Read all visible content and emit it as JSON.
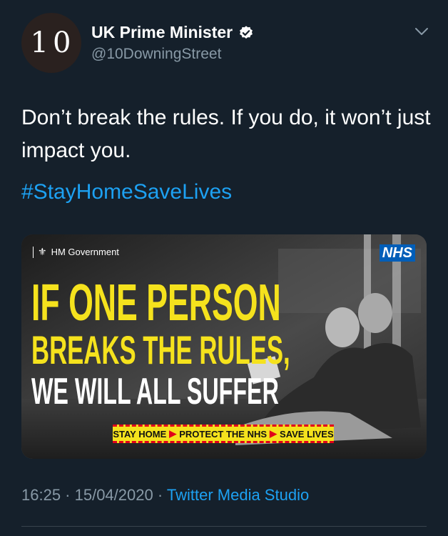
{
  "tweet": {
    "avatar_text": "10",
    "display_name": "UK Prime Minister",
    "handle": "@10DowningStreet",
    "verified": true,
    "menu_icon": "chevron-down-icon",
    "text": "Don’t break the rules. If you do, it won’t just impact you.",
    "hashtag": "#StayHomeSaveLives",
    "timestamp": "16:25 · 15/04/2020 · ",
    "source": "Twitter Media Studio"
  },
  "media": {
    "hm_gov_label": "HM Government",
    "nhs_logo": "NHS",
    "headline_line1": "IF ONE PERSON",
    "headline_line2": "BREAKS THE RULES,",
    "headline_line3": "WE WILL ALL SUFFER",
    "banner_stay_home": "STAY HOME",
    "banner_protect": "PROTECT THE NHS",
    "banner_save": "SAVE LIVES"
  },
  "colors": {
    "background": "#15202b",
    "link": "#1da1f2",
    "secondary_text": "#8899a6",
    "campaign_yellow": "#f5e21d",
    "nhs_blue": "#005eb8"
  }
}
